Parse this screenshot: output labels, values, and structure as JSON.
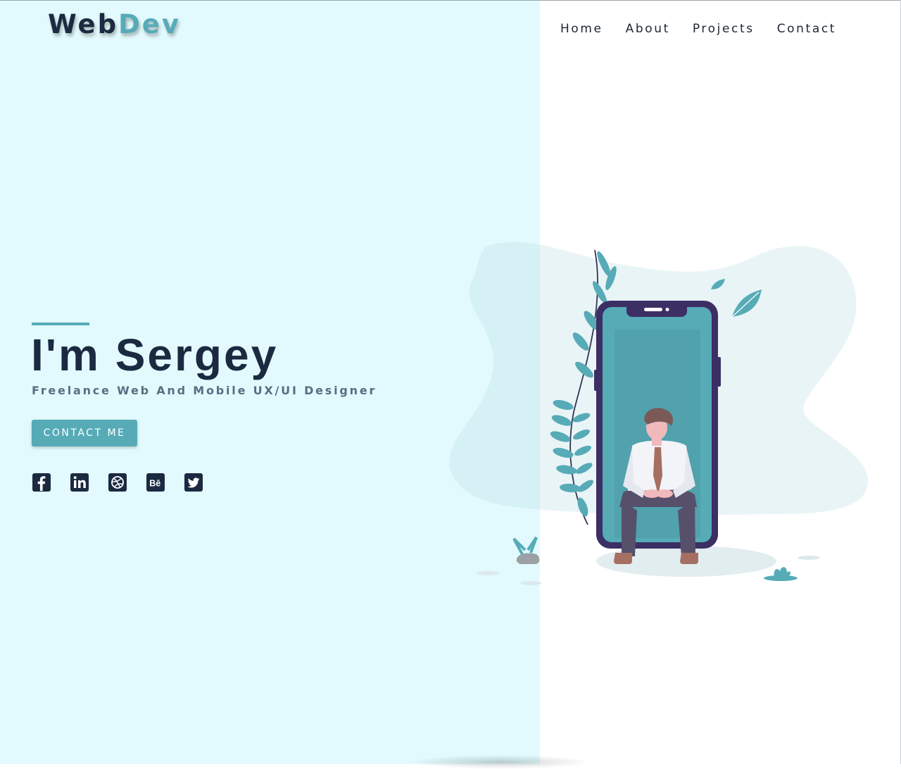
{
  "brand": {
    "part1": "Web",
    "part2": "Dev"
  },
  "nav": {
    "items": [
      {
        "label": "Home"
      },
      {
        "label": "About"
      },
      {
        "label": "Projects"
      },
      {
        "label": "Contact"
      }
    ]
  },
  "hero": {
    "headline": "I'm Sergey",
    "subtitle": "Freelance Web And Mobile UX/UI Designer",
    "cta_label": "CONTACT ME"
  },
  "socials": [
    {
      "icon": "facebook-icon"
    },
    {
      "icon": "linkedin-icon"
    },
    {
      "icon": "dribbble-icon"
    },
    {
      "icon": "behance-icon"
    },
    {
      "icon": "twitter-icon"
    }
  ],
  "colors": {
    "left_panel": "#e2fafd",
    "accent": "#56abb7",
    "dark": "#1b2a40",
    "phone_frame": "#3b2f63"
  }
}
